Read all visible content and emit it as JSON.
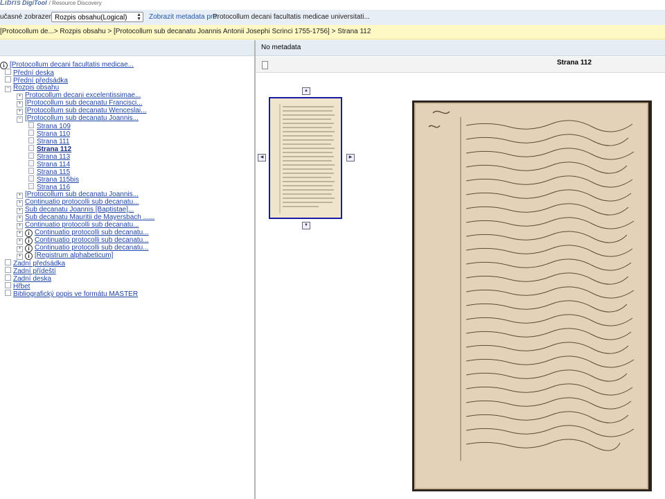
{
  "header": {
    "logo_a": "Libris",
    "logo_b": "DigiTool",
    "logo_c": "/ Resource Discovery"
  },
  "viewbar": {
    "label": "učasné zobrazení:",
    "select_value": "Rozpis obsahu(Logical)",
    "metadata_link": "Zobrazit metadata pro:",
    "metadata_value": "Protocollum decani facultatis medicae universitati..."
  },
  "breadcrumb": "[Protocollum de...> Rozpis obsahu > [Protocollum sub decanatu Joannis Antonii Josephi Scrinci 1755-1756] > Strana 112",
  "tree": [
    {
      "label": "[Protocollum decani facultatis medicae...",
      "icon": "info"
    },
    {
      "label": "Přední deska",
      "icon": "doc"
    },
    {
      "label": "Přední předsádka",
      "icon": "doc"
    },
    {
      "label": "Rozpis obsahu",
      "icon": "minus"
    },
    {
      "label": "Protocollum decani excelentissimae...",
      "icon": "plus"
    },
    {
      "label": "[Protocollum sub decanatu Francisci...",
      "icon": "plus"
    },
    {
      "label": "[Protocollum sub decanatu Wenceslai...",
      "icon": "plus"
    },
    {
      "label": "[Protocollum sub decanatu Joannis...",
      "icon": "minus"
    },
    {
      "label": "Strana 109",
      "icon": "page"
    },
    {
      "label": "Strana 110",
      "icon": "page"
    },
    {
      "label": "Strana 111",
      "icon": "page"
    },
    {
      "label": "Strana 112",
      "icon": "page"
    },
    {
      "label": "Strana 113",
      "icon": "page"
    },
    {
      "label": "Strana 114",
      "icon": "page"
    },
    {
      "label": "Strana 115",
      "icon": "page"
    },
    {
      "label": "Strana 115bis",
      "icon": "page"
    },
    {
      "label": "Strana 116",
      "icon": "page"
    },
    {
      "label": "[Protocollum sub decanatu Joannis...",
      "icon": "plus"
    },
    {
      "label": "Continuatio protocolli sub decanatu...",
      "icon": "plus"
    },
    {
      "label": "Sub decanatu Joannis [Baptistae]...",
      "icon": "plus"
    },
    {
      "label": "Sub decanatu Mauritii de Mayersbach ......",
      "icon": "plus"
    },
    {
      "label": "Continuatio protocolli sub decanatu...",
      "icon": "plus"
    },
    {
      "label": "Continuatio protocolli sub decanatu...",
      "icon": "plus-info"
    },
    {
      "label": "Continuatio protocolli sub decanatu...",
      "icon": "plus-info"
    },
    {
      "label": "Continuatio protocolli sub decanatu...",
      "icon": "plus-info"
    },
    {
      "label": "[Registrum alphabeticum]",
      "icon": "plus-info"
    },
    {
      "label": "Zadní předsádka",
      "icon": "doc"
    },
    {
      "label": "Zadní přídeští",
      "icon": "doc"
    },
    {
      "label": "Zadní deska",
      "icon": "doc"
    },
    {
      "label": "Hřbet",
      "icon": "doc"
    },
    {
      "label": "Bibliografický popis ve formátu MASTER",
      "icon": "doc"
    }
  ],
  "viewer": {
    "no_metadata": "No metadata",
    "page_title": "Strana 112"
  }
}
